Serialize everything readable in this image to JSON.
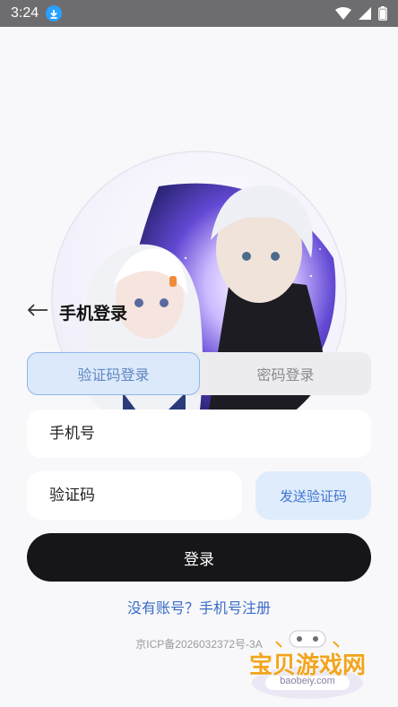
{
  "status_bar": {
    "time": "3:24",
    "download_icon": "download-icon",
    "wifi_icon": "wifi-icon",
    "signal_icon": "signal-icon",
    "battery_icon": "battery-icon"
  },
  "header": {
    "back_icon": "arrow-left-icon",
    "title": "手机登录"
  },
  "tabs": [
    {
      "label": "验证码登录",
      "active": true
    },
    {
      "label": "密码登录",
      "active": false
    }
  ],
  "form": {
    "phone_placeholder": "手机号",
    "code_placeholder": "验证码",
    "send_code_label": "发送验证码",
    "login_label": "登录"
  },
  "footer": {
    "register_link": "没有账号？手机号注册",
    "icp": "京ICP备2026032372号-3A"
  },
  "watermark": {
    "title": "宝贝游戏网",
    "url": "baobeiy.com"
  },
  "colors": {
    "accent": "#3f74d1",
    "button": "#161618",
    "active_tab_bg": "#dce9fa"
  }
}
